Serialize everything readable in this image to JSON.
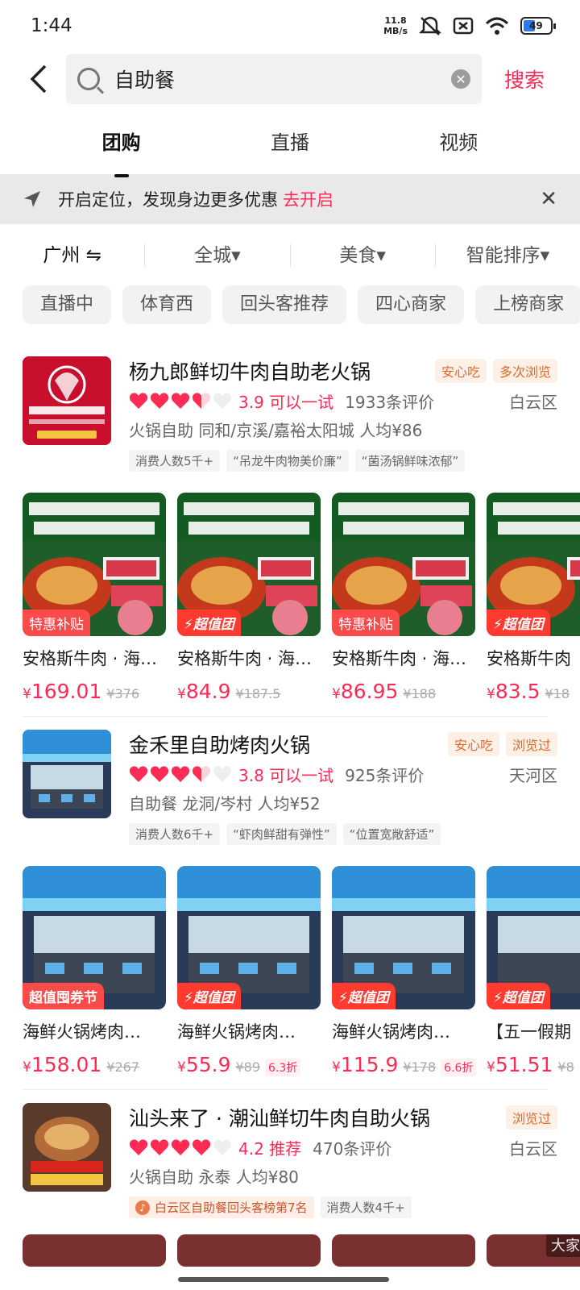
{
  "status": {
    "time": "1:44",
    "speed_top": "11.8",
    "speed_bottom": "MB/s",
    "battery": "49"
  },
  "search": {
    "query": "自助餐",
    "button": "搜索"
  },
  "tabs": [
    "团购",
    "直播",
    "视频"
  ],
  "location_bar": {
    "text": "开启定位，发现身边更多优惠",
    "action": "去开启",
    "close": "✕"
  },
  "filters": [
    "广州 ⇋",
    "全城▾",
    "美食▾",
    "智能排序▾"
  ],
  "chips": [
    "直播中",
    "体育西",
    "回头客推荐",
    "四心商家",
    "上榜商家"
  ],
  "shops": [
    {
      "name": "杨九郎鲜切牛肉自助老火锅",
      "tags": [
        "安心吃",
        "多次浏览"
      ],
      "score": "3.9 可以一试",
      "reviews": "1933条评价",
      "district": "白云区",
      "category": "火锅自助  同和/京溪/嘉裕太阳城  人均¥86",
      "badges": [
        "消费人数5千+",
        "“吊龙牛肉物美价廉”",
        "“菌汤锅鲜味浓郁”"
      ],
      "deals": [
        {
          "title": "安格斯牛肉 · 海鲜…",
          "label": "特惠补贴",
          "price": "169.01",
          "old": "¥376",
          "discount": ""
        },
        {
          "title": "安格斯牛肉 · 海鲜…",
          "label": "⚡超值团",
          "price": "84.9",
          "old": "¥187.5",
          "discount": ""
        },
        {
          "title": "安格斯牛肉 · 海鲜…",
          "label": "特惠补贴",
          "price": "86.95",
          "old": "¥188",
          "discount": ""
        },
        {
          "title": "安格斯牛肉",
          "label": "⚡超值团",
          "price": "83.5",
          "old": "¥18",
          "discount": ""
        }
      ]
    },
    {
      "name": "金禾里自助烤肉火锅",
      "tags": [
        "安心吃",
        "浏览过"
      ],
      "score": "3.8 可以一试",
      "reviews": "925条评价",
      "district": "天河区",
      "category": "自助餐  龙洞/岑村  人均¥52",
      "badges": [
        "消费人数6千+",
        "“虾肉鲜甜有弹性”",
        "“位置宽敞舒适”"
      ],
      "deals": [
        {
          "title": "海鲜火锅烤肉…",
          "label": "超值囤券节",
          "price": "158.01",
          "old": "¥267",
          "discount": ""
        },
        {
          "title": "海鲜火锅烤肉…",
          "label": "⚡超值团",
          "price": "55.9",
          "old": "¥89",
          "discount": "6.3折"
        },
        {
          "title": "海鲜火锅烤肉…",
          "label": "⚡超值团",
          "price": "115.9",
          "old": "¥178",
          "discount": "6.6折"
        },
        {
          "title": "【五一假期",
          "label": "⚡超值团",
          "price": "51.51",
          "old": "¥8",
          "discount": ""
        }
      ]
    },
    {
      "name": "汕头来了 · 潮汕鲜切牛肉自助火锅",
      "tags": [
        "浏览过"
      ],
      "score": "4.2 推荐",
      "reviews": "470条评价",
      "district": "白云区",
      "category": "火锅自助  永泰  人均¥80",
      "badges": [
        "白云区自助餐回头客榜第7名",
        "消费人数4千+"
      ],
      "hot_text": "大家都看"
    }
  ],
  "colors": {
    "accent": "#fe2c55",
    "tag_orange": "#e06a2d"
  }
}
